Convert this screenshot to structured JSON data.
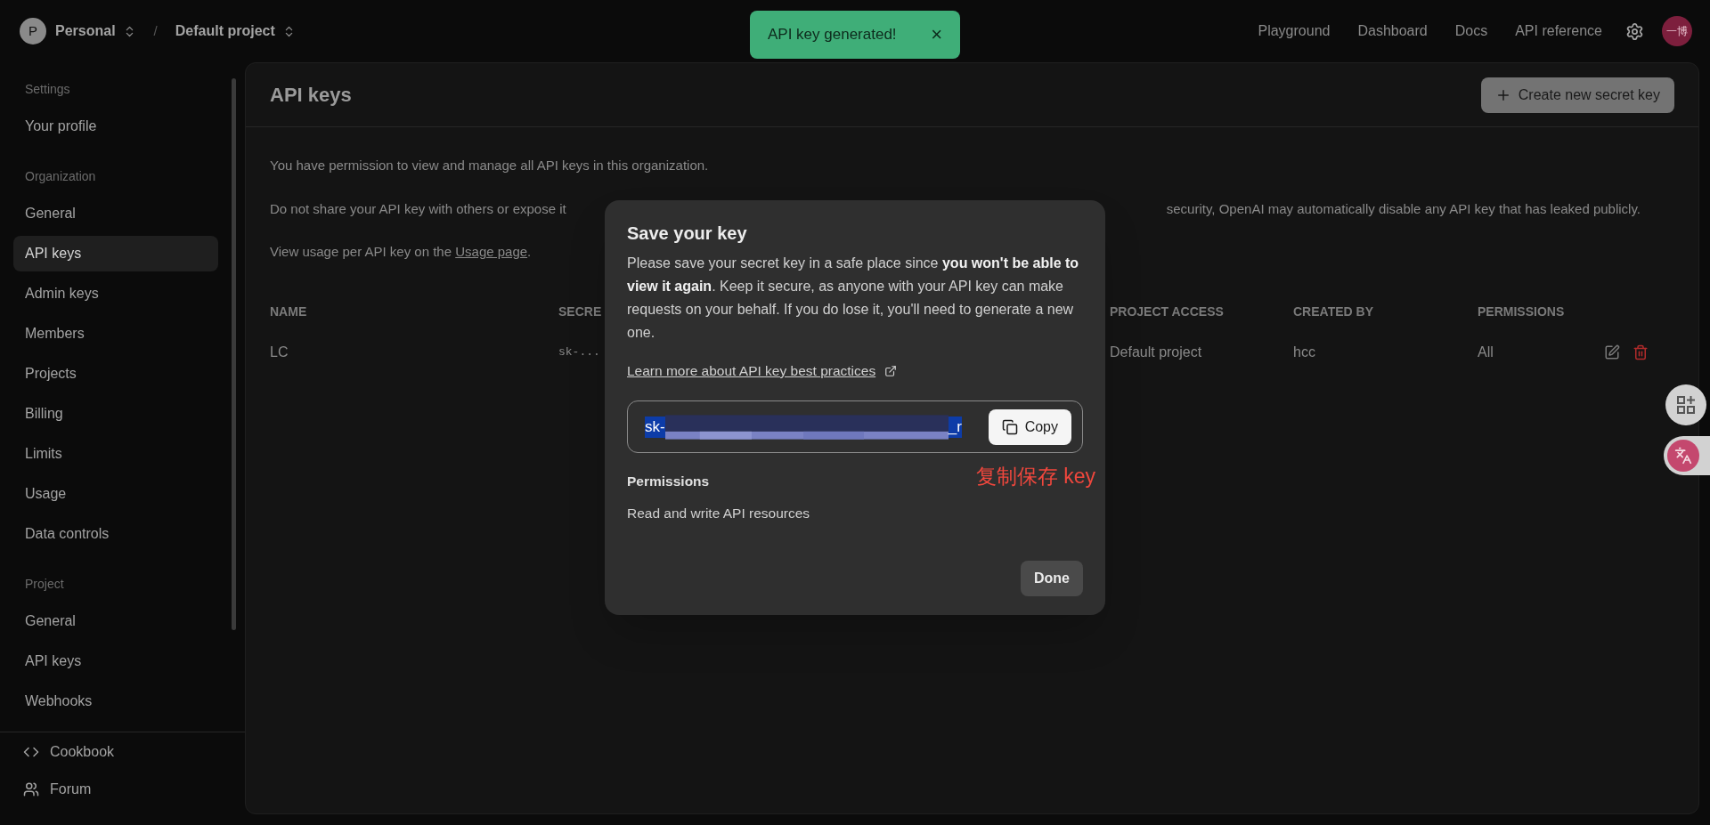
{
  "top_bar": {
    "organization": {
      "initial": "P",
      "name": "Personal"
    },
    "separator": "/",
    "project": "Default project",
    "nav_links": [
      "Playground",
      "Dashboard",
      "Docs",
      "API reference"
    ],
    "avatar_text": "一博"
  },
  "toast": {
    "message": "API key generated!",
    "close": "×"
  },
  "sidebar": {
    "sections": [
      {
        "heading": "Settings",
        "items": [
          {
            "label": "Your profile",
            "selected": false
          }
        ]
      },
      {
        "heading": "Organization",
        "items": [
          {
            "label": "General",
            "selected": false
          },
          {
            "label": "API keys",
            "selected": true
          },
          {
            "label": "Admin keys",
            "selected": false
          },
          {
            "label": "Members",
            "selected": false
          },
          {
            "label": "Projects",
            "selected": false
          },
          {
            "label": "Billing",
            "selected": false
          },
          {
            "label": "Limits",
            "selected": false
          },
          {
            "label": "Usage",
            "selected": false
          },
          {
            "label": "Data controls",
            "selected": false
          }
        ]
      },
      {
        "heading": "Project",
        "items": [
          {
            "label": "General",
            "selected": false
          },
          {
            "label": "API keys",
            "selected": false
          },
          {
            "label": "Webhooks",
            "selected": false
          }
        ]
      }
    ],
    "footer_links": [
      {
        "label": "Cookbook",
        "kind": "code"
      },
      {
        "label": "Forum",
        "kind": "people"
      }
    ]
  },
  "page": {
    "title": "API keys",
    "create_button": "Create new secret key",
    "permission_note": "You have permission to view and manage all API keys in this organization.",
    "warning": {
      "start": "Do not share your API key with others or expose it",
      "end": "security, OpenAI may automatically disable any API key that has leaked publicly."
    },
    "usage_note": {
      "before": "View usage per API key on the ",
      "link": "Usage page",
      "after": "."
    },
    "table": {
      "columns": [
        "NAME",
        "SECRE",
        "PROJECT ACCESS",
        "CREATED BY",
        "PERMISSIONS"
      ],
      "rows": [
        {
          "cells": [
            "LC",
            "sk-...",
            "Default project",
            "hcc",
            "All"
          ]
        }
      ]
    }
  },
  "modal": {
    "title": "Save your key",
    "body": "Please save your secret key in a safe place since **you won't be able to view it again**. Keep it secure, as anyone with your API key can make requests on your behalf. If you do lose it, you'll need to generate a new one.",
    "link": "Learn more about API key best practices",
    "key_start": "sk-",
    "key_end": "_r",
    "copy_button": "Copy",
    "annotation": "复制保存 key",
    "permissions_heading": "Permissions",
    "permissions_value": "Read and write API resources",
    "done_button": "Done"
  }
}
